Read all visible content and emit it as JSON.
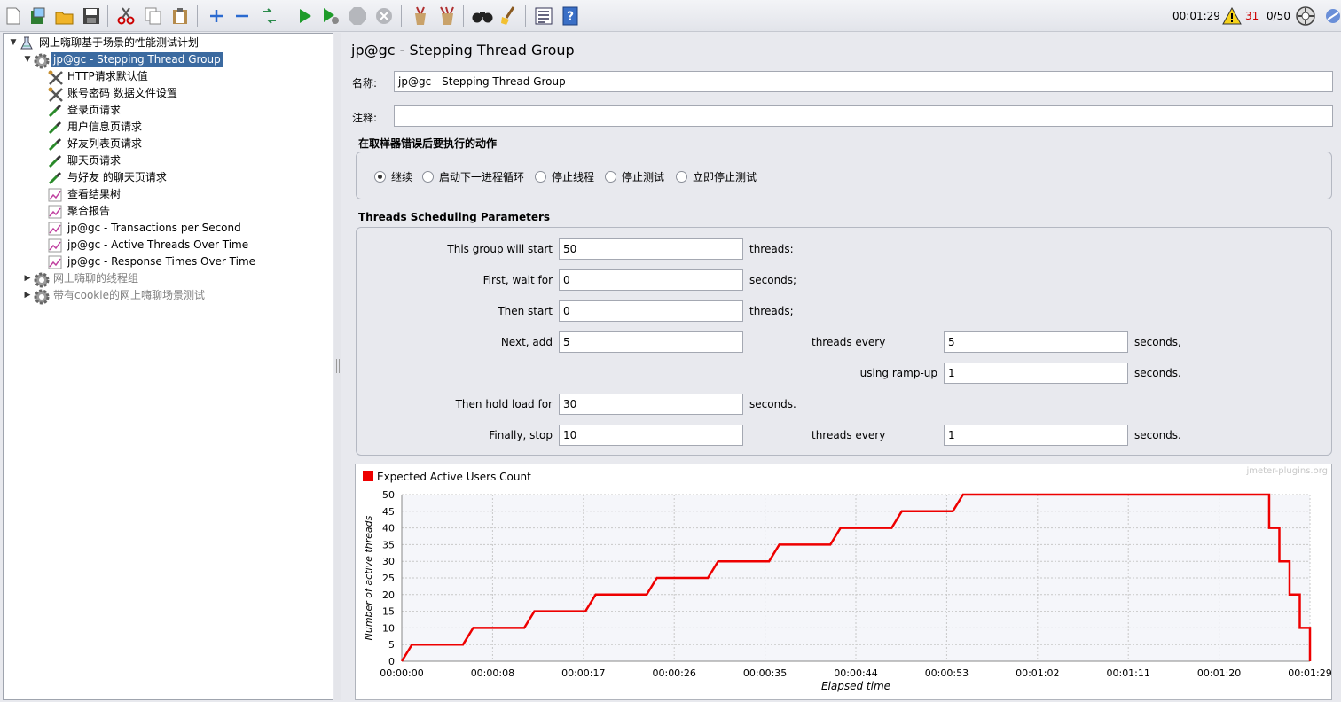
{
  "toolbar": {
    "elapsed_time": "00:01:29",
    "warning_count": "31",
    "threads_status": "0/50",
    "colors": {
      "warning": "#cc0000"
    }
  },
  "tree": {
    "items": [
      {
        "label": "网上嗨聊基于场景的性能测试计划",
        "icon": "test-plan-icon",
        "expander": "▼",
        "disabled": false,
        "selected": false
      },
      {
        "label": "jp@gc - Stepping Thread Group",
        "icon": "gear-icon",
        "expander": "▼",
        "disabled": false,
        "selected": true
      },
      {
        "label": "HTTP请求默认值",
        "icon": "config-tools-icon",
        "expander": "",
        "disabled": false,
        "selected": false
      },
      {
        "label": "账号密码 数据文件设置",
        "icon": "config-tools-icon",
        "expander": "",
        "disabled": false,
        "selected": false
      },
      {
        "label": "登录页请求",
        "icon": "sampler-pipette-icon",
        "expander": "",
        "disabled": false,
        "selected": false
      },
      {
        "label": "用户信息页请求",
        "icon": "sampler-pipette-icon",
        "expander": "",
        "disabled": false,
        "selected": false
      },
      {
        "label": "好友列表页请求",
        "icon": "sampler-pipette-icon",
        "expander": "",
        "disabled": false,
        "selected": false
      },
      {
        "label": "聊天页请求",
        "icon": "sampler-pipette-icon",
        "expander": "",
        "disabled": false,
        "selected": false
      },
      {
        "label": "与好友 的聊天页请求",
        "icon": "sampler-pipette-icon",
        "expander": "",
        "disabled": false,
        "selected": false
      },
      {
        "label": "查看结果树",
        "icon": "listener-graph-icon",
        "expander": "",
        "disabled": false,
        "selected": false
      },
      {
        "label": "聚合报告",
        "icon": "listener-graph-icon",
        "expander": "",
        "disabled": false,
        "selected": false
      },
      {
        "label": "jp@gc - Transactions per Second",
        "icon": "listener-graph-icon",
        "expander": "",
        "disabled": false,
        "selected": false
      },
      {
        "label": "jp@gc - Active Threads Over Time",
        "icon": "listener-graph-icon",
        "expander": "",
        "disabled": false,
        "selected": false
      },
      {
        "label": "jp@gc - Response Times Over Time",
        "icon": "listener-graph-icon",
        "expander": "",
        "disabled": false,
        "selected": false
      },
      {
        "label": "网上嗨聊的线程组",
        "icon": "gear-icon",
        "expander": "▶",
        "disabled": true,
        "selected": false
      },
      {
        "label": "带有cookie的网上嗨聊场景测试",
        "icon": "gear-icon",
        "expander": "▶",
        "disabled": true,
        "selected": false
      }
    ]
  },
  "panel": {
    "title": "jp@gc - Stepping Thread Group",
    "name_label": "名称:",
    "name_value": "jp@gc - Stepping Thread Group",
    "comment_label": "注释:",
    "comment_value": "",
    "error_action_header": "在取样器错误后要执行的动作",
    "error_actions": [
      {
        "label": "继续",
        "selected": true
      },
      {
        "label": "启动下一进程循环",
        "selected": false
      },
      {
        "label": "停止线程",
        "selected": false
      },
      {
        "label": "停止测试",
        "selected": false
      },
      {
        "label": "立即停止测试",
        "selected": false
      }
    ],
    "scheduling_header": "Threads Scheduling Parameters",
    "params": {
      "start_label": "This group will start",
      "start_value": "50",
      "start_unit": "threads:",
      "wait_label": "First, wait for",
      "wait_value": "0",
      "wait_unit": "seconds;",
      "then_start_label": "Then start",
      "then_start_value": "0",
      "then_start_unit": "threads;",
      "next_add_label": "Next, add",
      "next_add_value": "5",
      "next_add_mid": "threads every",
      "next_add_every_value": "5",
      "next_add_unit": "seconds,",
      "rampup_label": "using ramp-up",
      "rampup_value": "1",
      "rampup_unit": "seconds.",
      "hold_label": "Then hold load for",
      "hold_value": "30",
      "hold_unit": "seconds.",
      "stop_label": "Finally, stop",
      "stop_value": "10",
      "stop_mid": "threads every",
      "stop_every_value": "1",
      "stop_unit": "seconds."
    }
  },
  "chart_data": {
    "type": "line",
    "watermark": "jmeter-plugins.org",
    "xlabel": "Elapsed time",
    "ylabel": "Number of active threads",
    "legend": "Expected Active Users Count",
    "legend_position": "top-left",
    "color": "#ee0000",
    "grid": true,
    "ylim": [
      0,
      50
    ],
    "xlim": [
      0,
      89
    ],
    "yticks": [
      0,
      5,
      10,
      15,
      20,
      25,
      30,
      35,
      40,
      45,
      50
    ],
    "xticks": [
      {
        "v": 0,
        "label": "00:00:00"
      },
      {
        "v": 8.9,
        "label": "00:00:08"
      },
      {
        "v": 17.8,
        "label": "00:00:17"
      },
      {
        "v": 26.7,
        "label": "00:00:26"
      },
      {
        "v": 35.6,
        "label": "00:00:35"
      },
      {
        "v": 44.5,
        "label": "00:00:44"
      },
      {
        "v": 53.4,
        "label": "00:00:53"
      },
      {
        "v": 62.3,
        "label": "00:01:02"
      },
      {
        "v": 71.2,
        "label": "00:01:11"
      },
      {
        "v": 80.1,
        "label": "00:01:20"
      },
      {
        "v": 89,
        "label": "00:01:29"
      }
    ],
    "series": [
      {
        "name": "Expected Active Users Count",
        "points": [
          [
            0,
            0
          ],
          [
            1,
            5
          ],
          [
            6,
            5
          ],
          [
            7,
            10
          ],
          [
            12,
            10
          ],
          [
            13,
            15
          ],
          [
            18,
            15
          ],
          [
            19,
            20
          ],
          [
            24,
            20
          ],
          [
            25,
            25
          ],
          [
            30,
            25
          ],
          [
            31,
            30
          ],
          [
            36,
            30
          ],
          [
            37,
            35
          ],
          [
            42,
            35
          ],
          [
            43,
            40
          ],
          [
            48,
            40
          ],
          [
            49,
            45
          ],
          [
            54,
            45
          ],
          [
            55,
            50
          ],
          [
            85,
            50
          ],
          [
            85,
            40
          ],
          [
            86,
            40
          ],
          [
            86,
            30
          ],
          [
            87,
            30
          ],
          [
            87,
            20
          ],
          [
            88,
            20
          ],
          [
            88,
            10
          ],
          [
            89,
            10
          ],
          [
            89,
            0
          ]
        ]
      }
    ]
  }
}
